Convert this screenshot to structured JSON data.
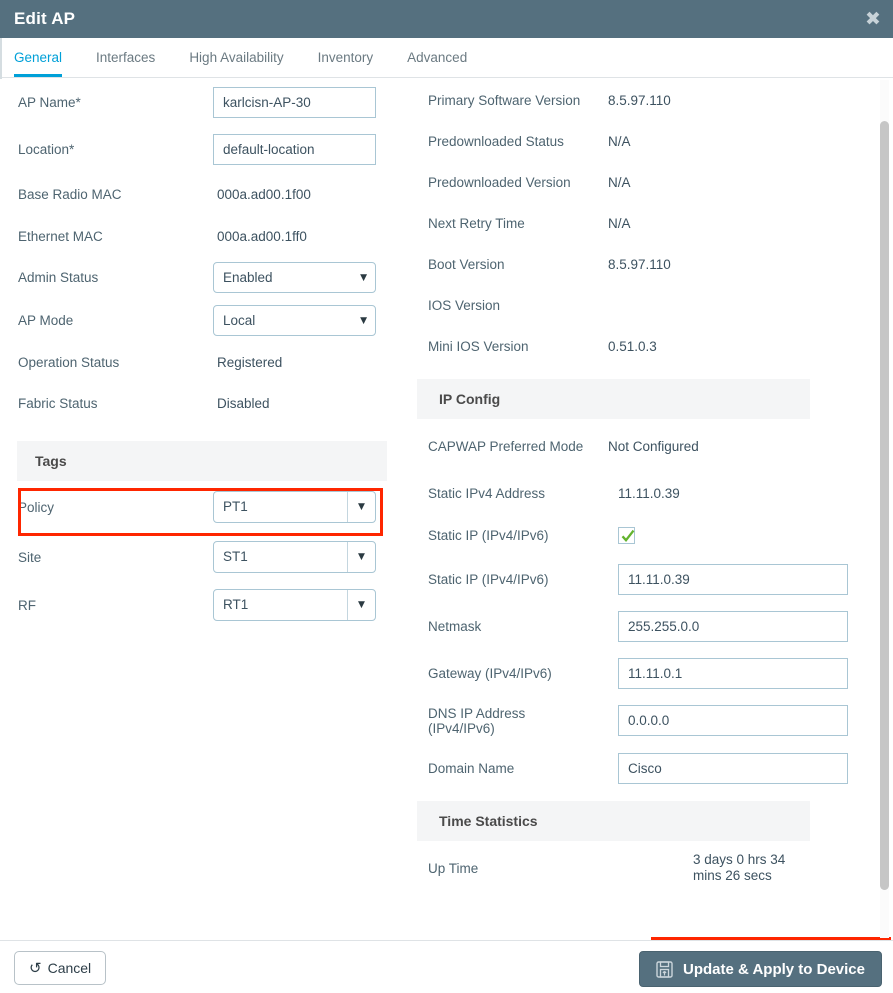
{
  "window": {
    "title": "Edit AP",
    "close_label": "✖"
  },
  "tabs": [
    {
      "label": "General",
      "active": true
    },
    {
      "label": "Interfaces",
      "active": false
    },
    {
      "label": "High Availability",
      "active": false
    },
    {
      "label": "Inventory",
      "active": false
    },
    {
      "label": "Advanced",
      "active": false
    }
  ],
  "left": {
    "ap_name": {
      "label": "AP Name*",
      "value": "karlcisn-AP-30"
    },
    "location": {
      "label": "Location*",
      "value": "default-location"
    },
    "base_radio_mac": {
      "label": "Base Radio MAC",
      "value": "000a.ad00.1f00"
    },
    "ethernet_mac": {
      "label": "Ethernet MAC",
      "value": "000a.ad00.1ff0"
    },
    "admin_status": {
      "label": "Admin Status",
      "value": "Enabled"
    },
    "ap_mode": {
      "label": "AP Mode",
      "value": "Local"
    },
    "operation_status": {
      "label": "Operation Status",
      "value": "Registered"
    },
    "fabric_status": {
      "label": "Fabric Status",
      "value": "Disabled"
    },
    "tags_section": "Tags",
    "policy": {
      "label": "Policy",
      "value": "PT1"
    },
    "site": {
      "label": "Site",
      "value": "ST1"
    },
    "rf": {
      "label": "RF",
      "value": "RT1"
    }
  },
  "right": {
    "primary_software_version": {
      "label": "Primary Software Version",
      "value": "8.5.97.110"
    },
    "predownloaded_status": {
      "label": "Predownloaded Status",
      "value": "N/A"
    },
    "predownloaded_version": {
      "label": "Predownloaded Version",
      "value": "N/A"
    },
    "next_retry_time": {
      "label": "Next Retry Time",
      "value": "N/A"
    },
    "boot_version": {
      "label": "Boot Version",
      "value": "8.5.97.110"
    },
    "ios_version": {
      "label": "IOS Version",
      "value": ""
    },
    "mini_ios_version": {
      "label": "Mini IOS Version",
      "value": "0.51.0.3"
    },
    "ip_config_section": "IP Config",
    "capwap_preferred_mode": {
      "label": "CAPWAP Preferred Mode",
      "value": "Not Configured"
    },
    "static_ipv4_address": {
      "label": "Static IPv4 Address",
      "value": "11.11.0.39"
    },
    "static_ip_checkbox": {
      "label": "Static IP (IPv4/IPv6)",
      "checked": true
    },
    "static_ip_field": {
      "label": "Static IP (IPv4/IPv6)",
      "value": "11.11.0.39"
    },
    "netmask": {
      "label": "Netmask",
      "value": "255.255.0.0"
    },
    "gateway": {
      "label": "Gateway (IPv4/IPv6)",
      "value": "11.11.0.1"
    },
    "dns_ip_address": {
      "label_line1": "DNS IP Address",
      "label_line2": "(IPv4/IPv6)",
      "value": "0.0.0.0"
    },
    "domain_name": {
      "label": "Domain Name",
      "value": "Cisco"
    },
    "time_statistics_section": "Time Statistics",
    "up_time": {
      "label": "Up Time",
      "value_line1": "3 days 0 hrs 34",
      "value_line2": "mins 26 secs"
    }
  },
  "footer": {
    "cancel_label": "Cancel",
    "cancel_icon": "↺",
    "update_label": "Update & Apply to Device"
  },
  "colors": {
    "titlebar": "#55707f",
    "accent": "#00a0d8",
    "highlight": "#fe2600",
    "check": "#63b32e",
    "primary_button": "#55707f"
  }
}
